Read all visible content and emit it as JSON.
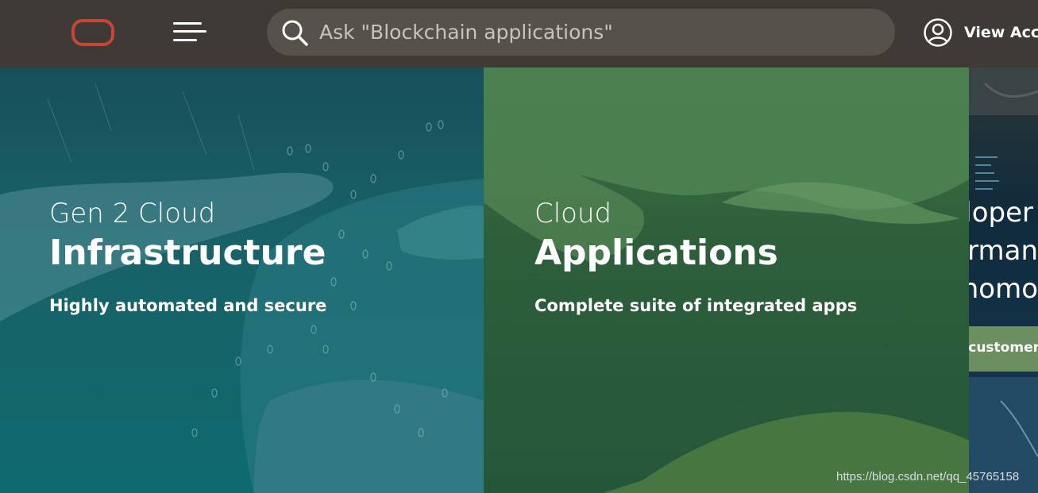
{
  "header": {
    "logo_name": "oracle-logo",
    "menu_icon": "hamburger-menu-icon",
    "search": {
      "icon": "search-icon",
      "placeholder": "Ask \"Blockchain applications\""
    },
    "account": {
      "icon": "user-circle-icon",
      "label": "View Acco"
    }
  },
  "panels": [
    {
      "kicker": "Gen 2 Cloud",
      "headline": "Infrastructure",
      "subline": "Highly automated and secure",
      "color": "#186168"
    },
    {
      "kicker": "Cloud",
      "headline": "Applications",
      "subline": "Complete suite of integrated apps",
      "color": "#2e5f3b"
    },
    {
      "lines": [
        "loper",
        "rman",
        "nomo"
      ],
      "button_label": "n customer"
    }
  ],
  "watermark": "https://blog.csdn.net/qq_45765158",
  "colors": {
    "topbar": "#3f3a36",
    "search_bg": "#57514c",
    "logo": "#c74634",
    "button": "#6b8f5e"
  }
}
